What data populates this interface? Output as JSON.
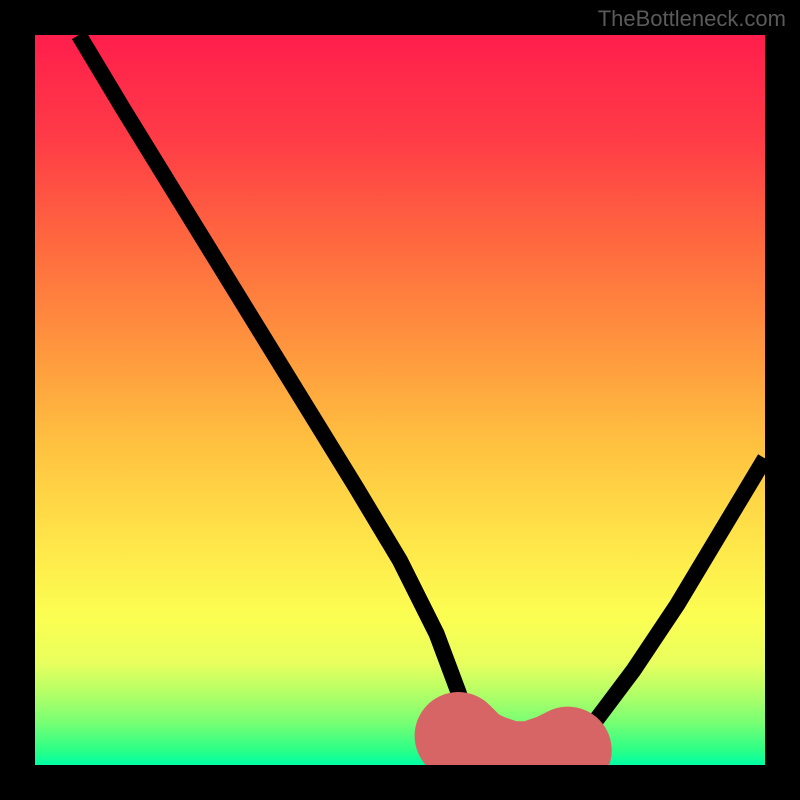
{
  "attribution": "TheBottleneck.com",
  "chart_data": {
    "type": "line",
    "title": "",
    "xlabel": "",
    "ylabel": "",
    "xlim": [
      0,
      100
    ],
    "ylim": [
      0,
      100
    ],
    "series": [
      {
        "name": "curve",
        "x": [
          6,
          12,
          20,
          28,
          36,
          44,
          50,
          55,
          58,
          60,
          63,
          66,
          69,
          72,
          76,
          82,
          88,
          94,
          100
        ],
        "values": [
          100,
          90,
          77,
          64,
          51,
          38,
          28,
          18,
          10,
          4,
          1,
          0,
          0,
          1,
          5,
          13,
          22,
          32,
          42
        ]
      },
      {
        "name": "marker",
        "x": [
          58,
          60,
          62,
          65,
          68,
          71,
          73
        ],
        "values": [
          4,
          2,
          1,
          0,
          0,
          1,
          2
        ]
      }
    ],
    "gradient": {
      "top": "#ff1e4c",
      "mid": "#ffe74a",
      "bottom": "#00ffa4"
    }
  }
}
